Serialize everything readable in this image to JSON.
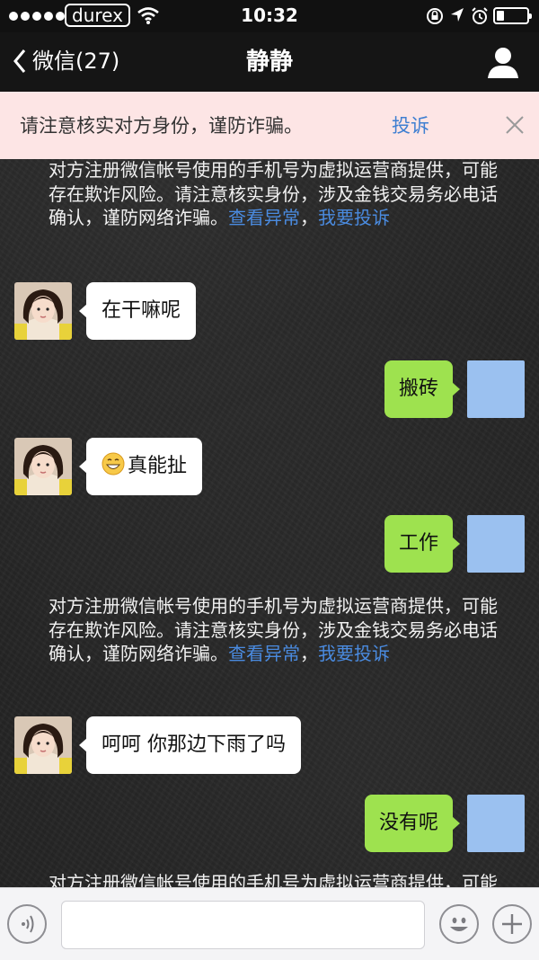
{
  "status_bar": {
    "carrier": "durex",
    "time": "10:32"
  },
  "nav": {
    "back_label": "微信(27)",
    "title": "静静"
  },
  "warning": {
    "text": "请注意核实对方身份，谨防诈骗。",
    "report_label": "投诉"
  },
  "system_notice": {
    "text": "对方注册微信帐号使用的手机号为虚拟运营商提供，可能存在欺诈风险。请注意核实身份，涉及金钱交易务必电话确认，谨防网络诈骗。",
    "link1": "查看异常",
    "separator": "，",
    "link2": "我要投诉"
  },
  "messages": [
    {
      "side": "in",
      "text": "在干嘛呢"
    },
    {
      "side": "out",
      "text": "搬砖"
    },
    {
      "side": "in",
      "text": "真能扯",
      "emoji": "grinning-face"
    },
    {
      "side": "out",
      "text": "工作"
    },
    {
      "side": "in",
      "text": "呵呵 你那边下雨了吗"
    },
    {
      "side": "out",
      "text": "没有呢"
    }
  ],
  "colors": {
    "incoming_bubble": "#ffffff",
    "outgoing_bubble": "#9ee24f",
    "link": "#3f7fd1",
    "warning_bg": "#fde5e5"
  }
}
